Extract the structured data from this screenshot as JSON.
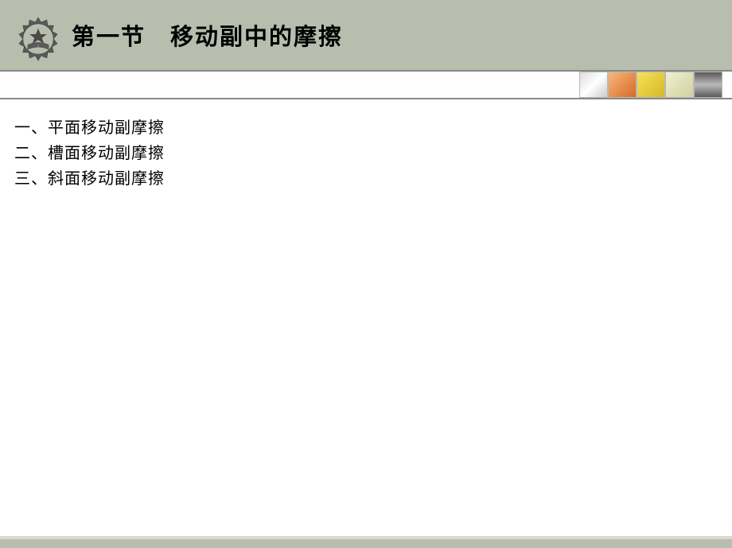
{
  "header": {
    "title": "第一节　移动副中的摩擦"
  },
  "bullets": [
    "一、平面移动副摩擦",
    "二、槽面移动副摩擦",
    "三、斜面移动副摩擦"
  ]
}
